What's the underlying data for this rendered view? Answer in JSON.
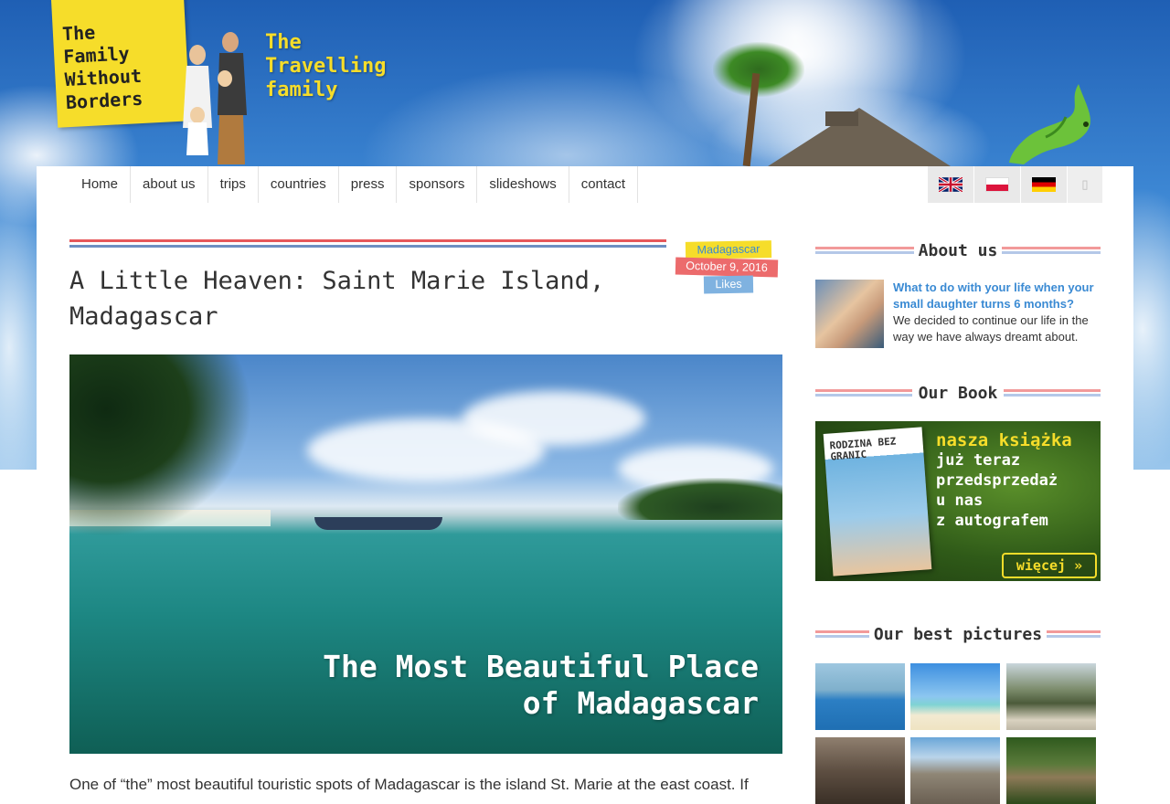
{
  "site": {
    "logo_lines": [
      "The",
      "Family",
      "Without",
      "Borders"
    ],
    "tagline_lines": [
      "The",
      "Travelling",
      "family"
    ]
  },
  "nav": {
    "items": [
      "Home",
      "about us",
      "trips",
      "countries",
      "press",
      "sponsors",
      "slideshows",
      "contact"
    ]
  },
  "languages": [
    {
      "name": "english-flag-icon"
    },
    {
      "name": "polish-flag-icon"
    },
    {
      "name": "german-flag-icon"
    },
    {
      "name": "more-languages-icon",
      "glyph": "▯"
    }
  ],
  "article": {
    "title": "A Little Heaven: Saint Marie Island, Madagascar",
    "country": "Madagascar",
    "date": "October 9, 2016",
    "likes": "Likes",
    "hero_caption_lines": [
      "The Most Beautiful Place",
      "of Madagascar"
    ],
    "intro": "One of “the” most beautiful touristic spots of Madagascar is the island St. Marie at the east coast. If"
  },
  "sidebar": {
    "about": {
      "heading": "About us",
      "link": "What to do with your life when your small daughter turns 6 months?",
      "text": "We decided to continue our life in the way we have always dreamt about."
    },
    "book": {
      "heading": "Our Book",
      "cover_title": "RODZINA BEZ GRANIC",
      "lines": [
        "nasza książka",
        "już teraz",
        "przedsprzedaż",
        "u nas",
        "z autografem"
      ],
      "more": "więcej »"
    },
    "pictures": {
      "heading": "Our best pictures"
    }
  },
  "colors": {
    "accent_yellow": "#f6dd2a",
    "accent_red": "#e6585b",
    "accent_blue": "#6d8fc2",
    "link_blue": "#3a8ad3"
  }
}
